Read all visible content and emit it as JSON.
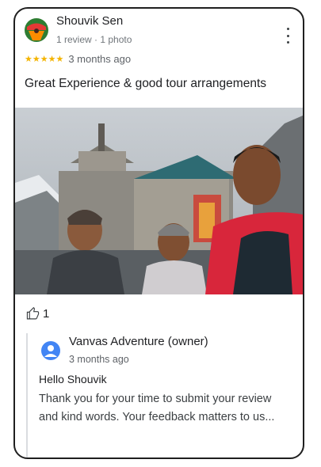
{
  "review": {
    "author_name": "Shouvik Sen",
    "author_meta": "1 review · 1 photo",
    "stars": "★★★★★",
    "rating_value": 5,
    "time_ago": "3 months ago",
    "text": "Great Experience & good tour arrangements",
    "photo_icon": "group-selfie-photo",
    "like_count": "1"
  },
  "owner_reply": {
    "name": "Vanvas Adventure (owner)",
    "time_ago": "3 months ago",
    "greeting": "Hello Shouvik",
    "text": "Thank you for your time to submit your review and kind words. Your feedback matters to us..."
  },
  "colors": {
    "star": "#f4b400",
    "owner_avatar": "#4285f4",
    "border": "#1f1f1f"
  }
}
